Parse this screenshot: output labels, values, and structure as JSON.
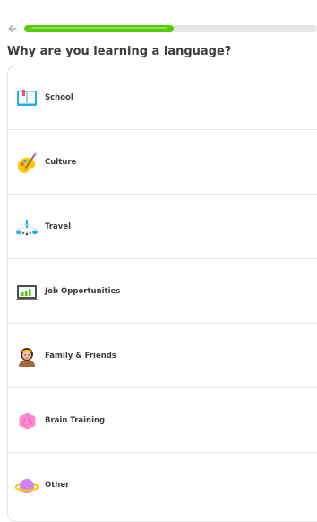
{
  "header": {
    "progress_percent": 51
  },
  "question": "Why are you learning a language?",
  "options": [
    {
      "label": "School",
      "icon": "book-icon"
    },
    {
      "label": "Culture",
      "icon": "palette-icon"
    },
    {
      "label": "Travel",
      "icon": "airplane-icon"
    },
    {
      "label": "Job Opportunities",
      "icon": "chart-laptop-icon"
    },
    {
      "label": "Family & Friends",
      "icon": "person-avatar-icon"
    },
    {
      "label": "Brain Training",
      "icon": "brain-icon"
    },
    {
      "label": "Other",
      "icon": "planet-icon"
    }
  ],
  "colors": {
    "accent": "#58cc02",
    "track": "#e5e5e5",
    "border": "#e5e5e5",
    "text": "#3c3c3c"
  }
}
